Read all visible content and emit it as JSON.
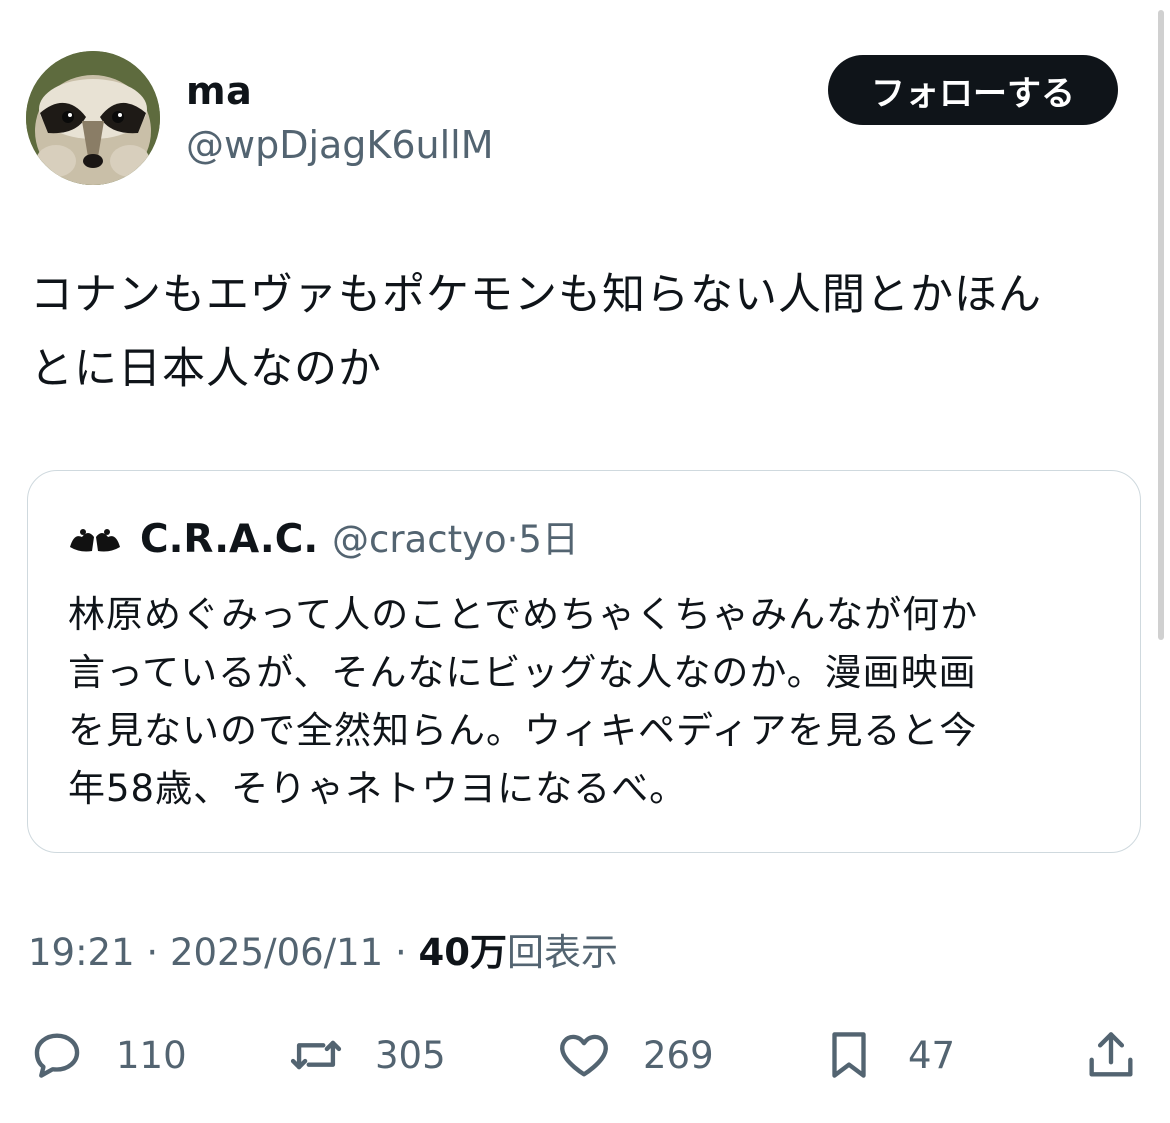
{
  "author": {
    "display_name": "ma",
    "handle": "@wpDjagK6ullM",
    "follow_label": "フォローする"
  },
  "tweet": {
    "text_line1": "コナンもエヴァもポケモンも知らない人間とかほん",
    "text_line2": "とに日本人なのか"
  },
  "quote": {
    "name": "C.R.A.C.",
    "handle": "@cractyo",
    "separator": "·",
    "age": "5日",
    "lines": [
      "林原めぐみって人のことでめちゃくちゃみんなが何か",
      "言っているが、そんなにビッグな人なのか。漫画映画",
      "を見ないので全然知らん。ウィキペディアを見ると今",
      "年58歳、そりゃネトウヨになるべ。"
    ]
  },
  "meta": {
    "time": "19:21",
    "date": "2025/06/11",
    "separator": "·",
    "views_count": "40万",
    "views_label": "回表示"
  },
  "actions": {
    "reply_count": "110",
    "retweet_count": "305",
    "like_count": "269",
    "bookmark_count": "47"
  },
  "colors": {
    "text": "#0f1419",
    "secondary": "#536471",
    "border": "#cfd9de",
    "button_bg": "#0f1419"
  },
  "icons": {
    "reply": "reply-icon",
    "retweet": "retweet-icon",
    "like": "heart-icon",
    "bookmark": "bookmark-icon",
    "share": "share-icon"
  }
}
